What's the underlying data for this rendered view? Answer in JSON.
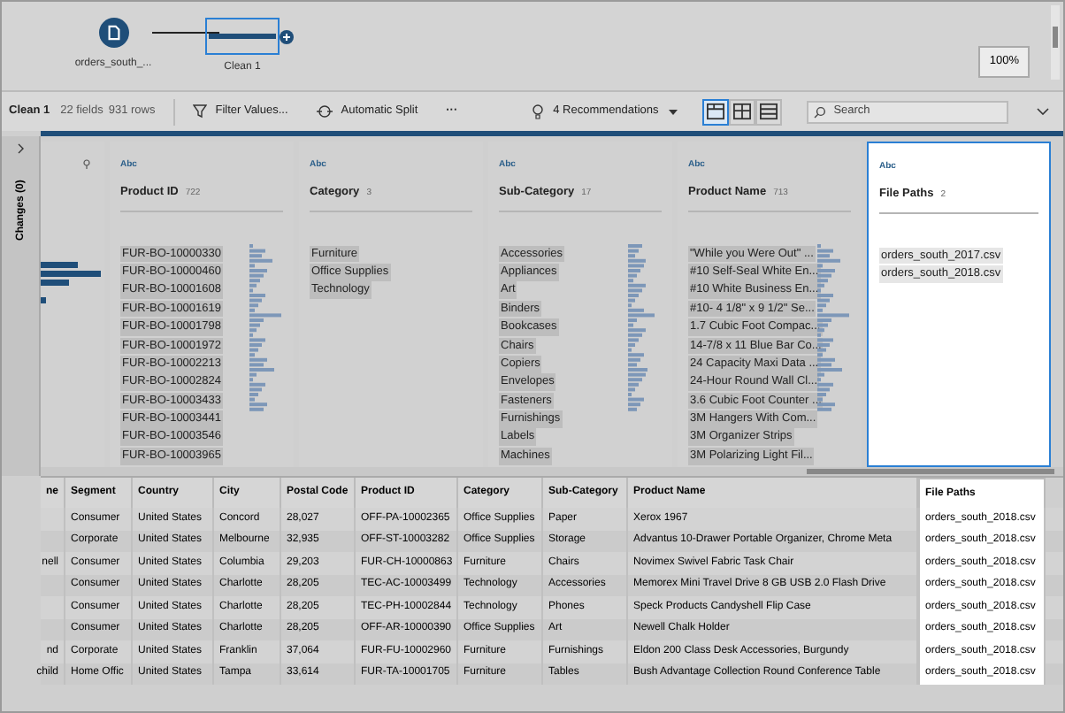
{
  "flow": {
    "nodes": [
      {
        "label": "orders_south_...",
        "kind": "input",
        "selected": false
      },
      {
        "label": "Clean 1",
        "kind": "clean",
        "selected": true
      }
    ],
    "zoom": "100%"
  },
  "toolbar": {
    "step": "Clean 1",
    "fields": "22 fields",
    "rows": "931 rows",
    "filter": "Filter Values...",
    "split": "Automatic Split",
    "more": "···",
    "recommendations": "4 Recommendations",
    "views": [
      {
        "kind": "profile",
        "selected": true
      },
      {
        "kind": "list",
        "selected": false
      },
      {
        "kind": "table",
        "selected": false
      }
    ],
    "search": {
      "placeholder": "Search"
    }
  },
  "changes_tab": "Changes (0)",
  "profile_cards": [
    {
      "type": "Abc",
      "name": "Product ID",
      "count": "722",
      "selected": false,
      "values": [
        {
          "text": "FUR-BO-10000330"
        },
        {
          "text": "FUR-BO-10000460"
        },
        {
          "text": "FUR-BO-10001608"
        },
        {
          "text": "FUR-BO-10001619"
        },
        {
          "text": "FUR-BO-10001798"
        },
        {
          "text": "FUR-BO-10001972"
        },
        {
          "text": "FUR-BO-10002213"
        },
        {
          "text": "FUR-BO-10002824"
        },
        {
          "text": "FUR-BO-10003433"
        },
        {
          "text": "FUR-BO-10003441"
        },
        {
          "text": "FUR-BO-10003546"
        },
        {
          "text": "FUR-BO-10003965"
        }
      ]
    },
    {
      "type": "Abc",
      "name": "Category",
      "count": "3",
      "selected": false,
      "values": [
        {
          "text": "Furniture"
        },
        {
          "text": "Office Supplies"
        },
        {
          "text": "Technology"
        }
      ]
    },
    {
      "type": "Abc",
      "name": "Sub-Category",
      "count": "17",
      "selected": false,
      "values": [
        {
          "text": "Accessories"
        },
        {
          "text": "Appliances"
        },
        {
          "text": "Art"
        },
        {
          "text": "Binders"
        },
        {
          "text": "Bookcases"
        },
        {
          "text": "Chairs"
        },
        {
          "text": "Copiers"
        },
        {
          "text": "Envelopes"
        },
        {
          "text": "Fasteners"
        },
        {
          "text": "Furnishings"
        },
        {
          "text": "Labels"
        },
        {
          "text": "Machines"
        }
      ]
    },
    {
      "type": "Abc",
      "name": "Product Name",
      "count": "713",
      "selected": false,
      "values": [
        {
          "text": "\"While you Were Out\" ..."
        },
        {
          "text": "#10 Self-Seal White En..."
        },
        {
          "text": "#10 White Business En..."
        },
        {
          "text": "#10- 4 1/8\" x 9 1/2\" Se..."
        },
        {
          "text": "1.7 Cubic Foot Compac..."
        },
        {
          "text": "14-7/8 x 11 Blue Bar Co..."
        },
        {
          "text": "24 Capacity Maxi Data ..."
        },
        {
          "text": "24-Hour Round Wall Cl..."
        },
        {
          "text": "3.6 Cubic Foot Counter ..."
        },
        {
          "text": "3M Hangers With Com..."
        },
        {
          "text": "3M Organizer Strips"
        },
        {
          "text": "3M Polarizing Light Fil..."
        }
      ]
    },
    {
      "type": "Abc",
      "name": "File Paths",
      "count": "2",
      "selected": true,
      "values": [
        {
          "text": "orders_south_2017.csv"
        },
        {
          "text": "orders_south_2018.csv"
        }
      ]
    }
  ],
  "table": {
    "columns": [
      "ne",
      "Segment",
      "Country",
      "City",
      "Postal Code",
      "Product ID",
      "Category",
      "Sub-Category",
      "Product Name",
      "File Paths"
    ],
    "rows": [
      [
        "",
        "Consumer",
        "United States",
        "Concord",
        "28,027",
        "OFF-PA-10002365",
        "Office Supplies",
        "Paper",
        "Xerox 1967",
        "orders_south_2018.csv"
      ],
      [
        "",
        "Corporate",
        "United States",
        "Melbourne",
        "32,935",
        "OFF-ST-10003282",
        "Office Supplies",
        "Storage",
        "Advantus 10-Drawer Portable Organizer, Chrome Meta",
        "orders_south_2018.csv"
      ],
      [
        "nell",
        "Consumer",
        "United States",
        "Columbia",
        "29,203",
        "FUR-CH-10000863",
        "Furniture",
        "Chairs",
        "Novimex Swivel Fabric Task Chair",
        "orders_south_2018.csv"
      ],
      [
        "",
        "Consumer",
        "United States",
        "Charlotte",
        "28,205",
        "TEC-AC-10003499",
        "Technology",
        "Accessories",
        "Memorex Mini Travel Drive 8 GB USB 2.0 Flash Drive",
        "orders_south_2018.csv"
      ],
      [
        "",
        "Consumer",
        "United States",
        "Charlotte",
        "28,205",
        "TEC-PH-10002844",
        "Technology",
        "Phones",
        "Speck Products Candyshell Flip Case",
        "orders_south_2018.csv"
      ],
      [
        "",
        "Consumer",
        "United States",
        "Charlotte",
        "28,205",
        "OFF-AR-10000390",
        "Office Supplies",
        "Art",
        "Newell Chalk Holder",
        "orders_south_2018.csv"
      ],
      [
        "nd",
        "Corporate",
        "United States",
        "Franklin",
        "37,064",
        "FUR-FU-10002960",
        "Furniture",
        "Furnishings",
        "Eldon 200 Class Desk Accessories, Burgundy",
        "orders_south_2018.csv"
      ],
      [
        "child",
        "Home Offic",
        "United States",
        "Tampa",
        "33,614",
        "FUR-TA-10001705",
        "Furniture",
        "Tables",
        "Bush Advantage Collection Round Conference Table",
        "orders_south_2018.csv"
      ]
    ]
  }
}
